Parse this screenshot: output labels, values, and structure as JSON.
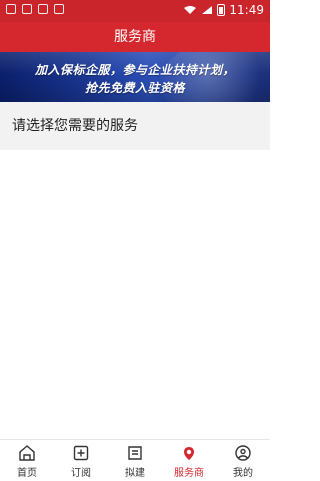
{
  "status_bar": {
    "time": "11:49"
  },
  "header": {
    "title": "服务商"
  },
  "banner": {
    "line1": "加入保标企服，参与企业扶持计划，",
    "line2": "抢先免费入驻资格"
  },
  "prompt": {
    "text": "请选择您需要的服务"
  },
  "tabbar": {
    "items": [
      {
        "label": "首页",
        "icon": "home-icon"
      },
      {
        "label": "订阅",
        "icon": "subscribe-icon"
      },
      {
        "label": "拟建",
        "icon": "draft-icon"
      },
      {
        "label": "服务商",
        "icon": "service-provider-icon",
        "active": true
      },
      {
        "label": "我的",
        "icon": "profile-icon"
      }
    ],
    "active_color": "#d4282e",
    "inactive_color": "#333333"
  },
  "colors": {
    "brand_red": "#d4282e"
  }
}
